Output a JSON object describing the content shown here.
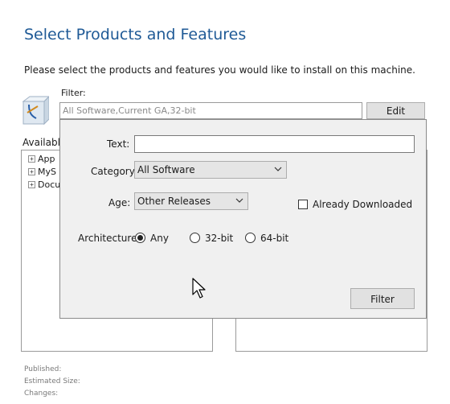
{
  "page": {
    "title": "Select Products and Features",
    "subtitle": "Please select the products and features you would like to install on this machine."
  },
  "filter": {
    "label": "Filter:",
    "value": "All Software,Current GA,32-bit",
    "edit_label": "Edit"
  },
  "available": {
    "label": "Available",
    "items": [
      {
        "expander": "+",
        "label": "App"
      },
      {
        "expander": "+",
        "label": "MyS"
      },
      {
        "expander": "+",
        "label": "Docu"
      }
    ]
  },
  "details": {
    "published": "Published:",
    "estimated_size": "Estimated Size:",
    "changes": "Changes:"
  },
  "popup": {
    "text_label": "Text:",
    "text_value": "",
    "category_label": "Category:",
    "category_value": "All Software",
    "age_label": "Age:",
    "age_value": "Other Releases",
    "already_downloaded_label": "Already Downloaded",
    "already_downloaded_checked": false,
    "architecture_label": "Architecture:",
    "architecture_options": [
      "Any",
      "32-bit",
      "64-bit"
    ],
    "architecture_selected": "Any",
    "filter_button": "Filter"
  },
  "icons": {
    "package": "package-icon",
    "dropdown": "chevron-down-icon",
    "cursor": "mouse-pointer-icon"
  },
  "colors": {
    "title": "#1f5a96",
    "popup_bg": "#f0f0f0",
    "button_bg": "#e1e1e1"
  }
}
